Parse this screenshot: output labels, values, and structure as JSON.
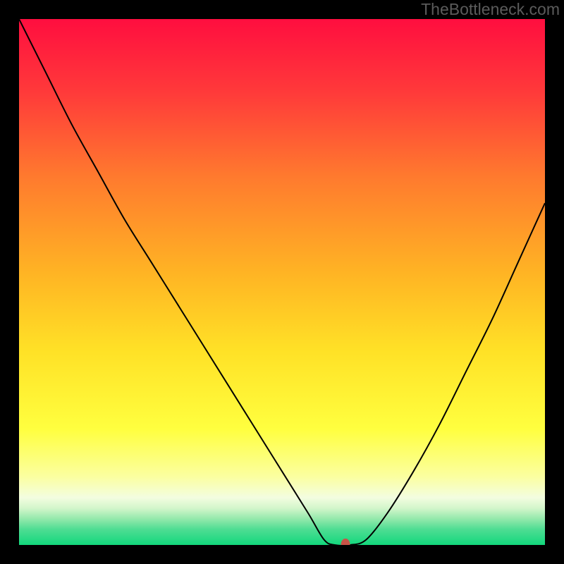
{
  "watermark": "TheBottleneck.com",
  "chart_data": {
    "type": "line",
    "title": "",
    "xlabel": "",
    "ylabel": "",
    "x_range": [
      0,
      100
    ],
    "y_range": [
      0,
      100
    ],
    "series": [
      {
        "name": "bottleneck-curve",
        "x": [
          0,
          5,
          10,
          15,
          20,
          25,
          30,
          35,
          40,
          45,
          50,
          55,
          58,
          60,
          63,
          66,
          70,
          75,
          80,
          85,
          90,
          95,
          100
        ],
        "y": [
          100,
          90,
          80,
          71,
          62,
          54,
          46,
          38,
          30,
          22,
          14,
          6,
          1,
          0,
          0,
          1,
          6,
          14,
          23,
          33,
          43,
          54,
          65
        ]
      }
    ],
    "marker": {
      "x": 62,
      "y": 0,
      "color": "#c85347"
    },
    "gradient_stops": [
      {
        "pct": 0,
        "color": "#ff0e3f"
      },
      {
        "pct": 14,
        "color": "#ff3a3a"
      },
      {
        "pct": 30,
        "color": "#ff7a2e"
      },
      {
        "pct": 48,
        "color": "#ffb324"
      },
      {
        "pct": 63,
        "color": "#ffe126"
      },
      {
        "pct": 78,
        "color": "#ffff3f"
      },
      {
        "pct": 87,
        "color": "#fbffa0"
      },
      {
        "pct": 91,
        "color": "#f3fde0"
      },
      {
        "pct": 93,
        "color": "#d3f6cb"
      },
      {
        "pct": 95,
        "color": "#95e9ac"
      },
      {
        "pct": 97,
        "color": "#4fdd93"
      },
      {
        "pct": 100,
        "color": "#12d77c"
      }
    ]
  }
}
